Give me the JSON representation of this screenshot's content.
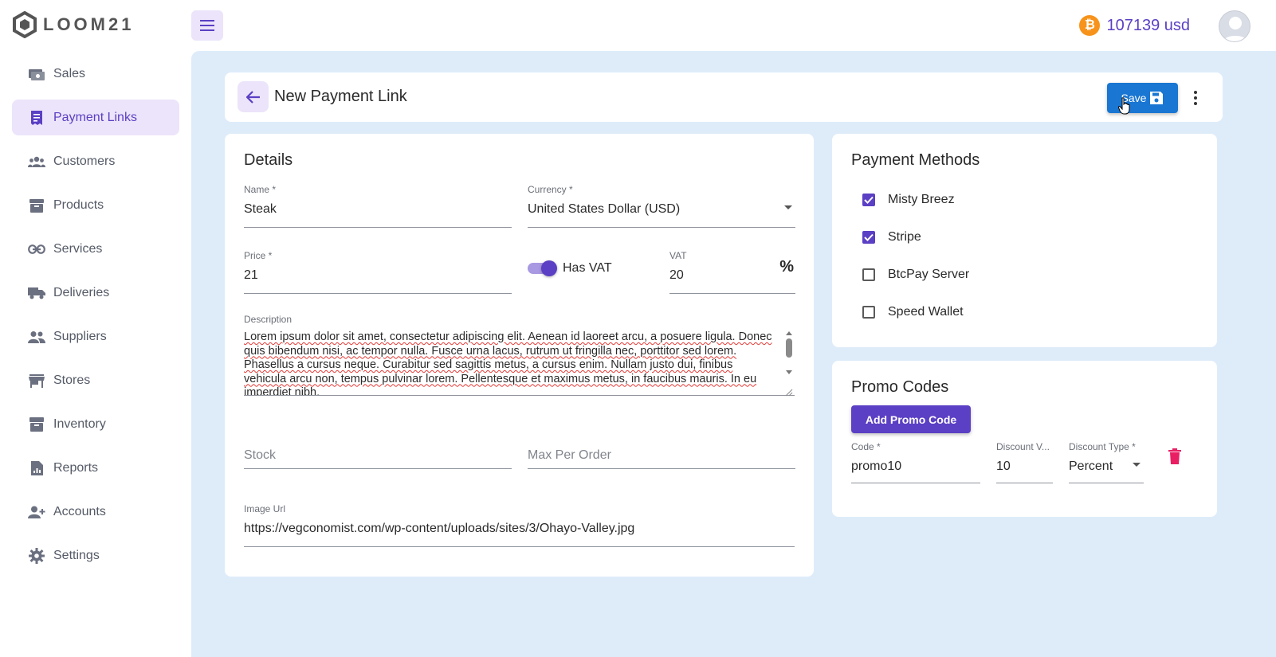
{
  "app": {
    "logo_text": "LOOM21"
  },
  "topbar": {
    "balance": "107139 usd",
    "btc_symbol": "₿"
  },
  "sidebar": {
    "items": [
      {
        "label": "Sales",
        "icon": "cash-icon"
      },
      {
        "label": "Payment Links",
        "icon": "receipt-icon",
        "active": true
      },
      {
        "label": "Customers",
        "icon": "groups-icon"
      },
      {
        "label": "Products",
        "icon": "archive-icon"
      },
      {
        "label": "Services",
        "icon": "link-icon"
      },
      {
        "label": "Deliveries",
        "icon": "truck-icon"
      },
      {
        "label": "Suppliers",
        "icon": "people-icon"
      },
      {
        "label": "Stores",
        "icon": "store-icon"
      },
      {
        "label": "Inventory",
        "icon": "inventory-icon"
      },
      {
        "label": "Reports",
        "icon": "report-icon"
      },
      {
        "label": "Accounts",
        "icon": "person-add-icon"
      },
      {
        "label": "Settings",
        "icon": "gear-icon"
      }
    ]
  },
  "header": {
    "title": "New Payment Link",
    "save_label": "Save"
  },
  "details": {
    "title": "Details",
    "name": {
      "label": "Name *",
      "value": "Steak"
    },
    "currency": {
      "label": "Currency *",
      "value": "United States Dollar (USD)"
    },
    "price": {
      "label": "Price *",
      "value": "21"
    },
    "has_vat": {
      "label": "Has VAT",
      "checked": true
    },
    "vat": {
      "label": "VAT",
      "value": "20",
      "suffix": "%"
    },
    "description": {
      "label": "Description",
      "value": "Lorem ipsum dolor sit amet, consectetur adipiscing elit. Aenean id laoreet arcu, a posuere ligula. Donec quis bibendum nisi, ac tempor nulla. Fusce urna lacus, rutrum ut fringilla nec, porttitor sed lorem. Phasellus a cursus neque. Curabitur sed sagittis metus, a cursus enim. Nullam justo dui, finibus vehicula arcu non, tempus pulvinar lorem. Pellentesque et maximus metus, in faucibus mauris. In eu imperdiet nibh."
    },
    "stock": {
      "placeholder": "Stock"
    },
    "max_per_order": {
      "placeholder": "Max Per Order"
    },
    "image_url": {
      "label": "Image Url",
      "value": "https://vegconomist.com/wp-content/uploads/sites/3/Ohayo-Valley.jpg"
    }
  },
  "payment_methods": {
    "title": "Payment Methods",
    "items": [
      {
        "label": "Misty Breez",
        "checked": true
      },
      {
        "label": "Stripe",
        "checked": true
      },
      {
        "label": "BtcPay Server",
        "checked": false
      },
      {
        "label": "Speed Wallet",
        "checked": false
      }
    ]
  },
  "promo_codes": {
    "title": "Promo Codes",
    "add_label": "Add Promo Code",
    "code": {
      "label": "Code *",
      "value": "promo10"
    },
    "discount_value": {
      "label": "Discount V...",
      "value": "10"
    },
    "discount_type": {
      "label": "Discount Type *",
      "value": "Percent"
    }
  },
  "colors": {
    "accent": "#5b3fc4",
    "primary_button": "#1976d2",
    "background": "#deecfa",
    "delete": "#e91e63"
  }
}
